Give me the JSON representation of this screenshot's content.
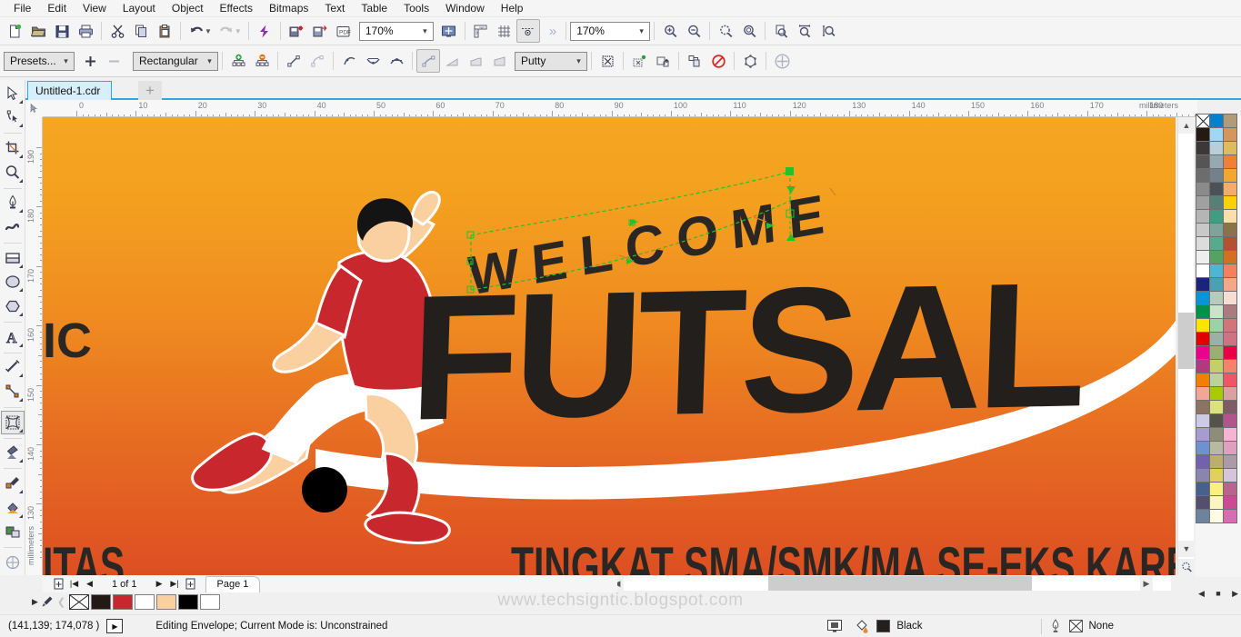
{
  "app": {
    "title": "CorelDRAW",
    "watermark": "www.techsigntic.blogspot.com"
  },
  "menubar": {
    "items": [
      {
        "label": "File"
      },
      {
        "label": "Edit"
      },
      {
        "label": "View"
      },
      {
        "label": "Layout"
      },
      {
        "label": "Object"
      },
      {
        "label": "Effects"
      },
      {
        "label": "Bitmaps"
      },
      {
        "label": "Text"
      },
      {
        "label": "Table"
      },
      {
        "label": "Tools"
      },
      {
        "label": "Window"
      },
      {
        "label": "Help"
      }
    ]
  },
  "toolbar": {
    "zoom_level": "170%",
    "view_zoom": "170%",
    "overflow_label": "»",
    "buttons": [
      {
        "name": "new-document",
        "icon": "new-file-icon"
      },
      {
        "name": "open-document",
        "icon": "folder-open-icon"
      },
      {
        "name": "save-document",
        "icon": "save-icon"
      },
      {
        "name": "print-document",
        "icon": "printer-icon"
      },
      {
        "name": "cut",
        "icon": "scissors-icon"
      },
      {
        "name": "copy",
        "icon": "copy-icon"
      },
      {
        "name": "paste",
        "icon": "paste-icon"
      },
      {
        "name": "undo",
        "icon": "undo-icon"
      },
      {
        "name": "redo",
        "icon": "redo-icon"
      },
      {
        "name": "search-content",
        "icon": "corel-connect-icon"
      },
      {
        "name": "import",
        "icon": "import-icon"
      },
      {
        "name": "export",
        "icon": "export-icon"
      },
      {
        "name": "publish-to-pdf",
        "icon": "pdf-icon"
      },
      {
        "name": "full-screen-preview",
        "icon": "fullscreen-icon"
      },
      {
        "name": "show-rulers",
        "icon": "ruler-icon"
      },
      {
        "name": "show-grid",
        "icon": "grid-icon"
      },
      {
        "name": "show-guidelines",
        "icon": "guidelines-icon"
      },
      {
        "name": "zoom-in",
        "icon": "zoom-in-icon"
      },
      {
        "name": "zoom-out",
        "icon": "zoom-out-icon"
      },
      {
        "name": "zoom-to-selection",
        "icon": "zoom-selection-icon"
      },
      {
        "name": "zoom-to-all-objects",
        "icon": "zoom-all-icon"
      },
      {
        "name": "zoom-to-page",
        "icon": "zoom-page-icon"
      },
      {
        "name": "zoom-to-page-width",
        "icon": "zoom-width-icon"
      },
      {
        "name": "zoom-to-page-height",
        "icon": "zoom-height-icon"
      }
    ]
  },
  "propertybar": {
    "presets_label": "Presets...",
    "add_preset_label": "+",
    "remove_preset_label": "−",
    "envelope_mode": "Rectangular",
    "mapping_mode": "Putty",
    "buttons": [
      {
        "name": "add-node",
        "icon": "add-node-icon"
      },
      {
        "name": "delete-node",
        "icon": "delete-node-icon"
      },
      {
        "name": "convert-to-line",
        "icon": "line-node-icon"
      },
      {
        "name": "convert-to-curve",
        "icon": "curve-node-icon"
      },
      {
        "name": "make-node-cusp",
        "icon": "cusp-node-icon"
      },
      {
        "name": "make-node-smooth",
        "icon": "smooth-node-icon"
      },
      {
        "name": "make-node-symmetrical",
        "icon": "symmetrical-node-icon"
      },
      {
        "name": "envelope-unconstrained",
        "icon": "unconstrained-icon"
      },
      {
        "name": "envelope-single-arc",
        "icon": "single-arc-icon"
      },
      {
        "name": "envelope-double-arc",
        "icon": "double-arc-icon"
      },
      {
        "name": "envelope-straight-line",
        "icon": "straight-line-icon"
      },
      {
        "name": "keep-lines",
        "icon": "keep-lines-icon"
      },
      {
        "name": "add-new-envelope",
        "icon": "add-envelope-icon"
      },
      {
        "name": "create-envelope-from",
        "icon": "copy-envelope-icon"
      },
      {
        "name": "copy-envelope-properties",
        "icon": "copy-props-icon"
      },
      {
        "name": "clear-envelope",
        "icon": "clear-envelope-icon"
      },
      {
        "name": "reset-envelope",
        "icon": "reset-envelope-icon"
      },
      {
        "name": "add-preset-plus",
        "icon": "plus-circle-icon"
      }
    ]
  },
  "document": {
    "tab_label": "Untitled-1.cdr",
    "new_tab_label": "+"
  },
  "rulers": {
    "unit": "millimeters",
    "horizontal_labels": [
      0,
      10,
      20,
      30,
      40,
      50,
      60,
      70,
      80,
      90,
      100,
      110,
      120,
      130,
      140,
      150,
      160,
      170,
      180
    ],
    "vertical_labels": [
      190,
      180,
      170,
      160,
      150,
      140,
      130
    ]
  },
  "toolbox": {
    "items": [
      {
        "name": "pick-tool",
        "icon": "arrow-cursor-icon",
        "active": false
      },
      {
        "name": "shape-edit-tool",
        "icon": "shape-node-icon",
        "active": false
      },
      {
        "name": "crop-tool",
        "icon": "crop-icon",
        "active": false
      },
      {
        "name": "zoom-tool",
        "icon": "magnifier-icon",
        "active": false
      },
      {
        "name": "freehand-tool",
        "icon": "pen-nib-icon",
        "active": false
      },
      {
        "name": "artistic-media-tool",
        "icon": "brush-stroke-icon",
        "active": false
      },
      {
        "name": "rectangle-tool",
        "icon": "rectangle-icon",
        "active": false
      },
      {
        "name": "ellipse-tool",
        "icon": "ellipse-icon",
        "active": false
      },
      {
        "name": "polygon-tool",
        "icon": "polygon-icon",
        "active": false
      },
      {
        "name": "text-tool",
        "icon": "letter-a-icon",
        "active": false
      },
      {
        "name": "parallel-dimension-tool",
        "icon": "dimension-icon",
        "active": false
      },
      {
        "name": "straight-line-connector-tool",
        "icon": "connector-icon",
        "active": false
      },
      {
        "name": "envelope-tool",
        "icon": "envelope-distort-icon",
        "active": true
      },
      {
        "name": "transparency-tool",
        "icon": "transparency-icon",
        "active": false
      },
      {
        "name": "color-eyedropper-tool",
        "icon": "eyedropper-icon",
        "active": false
      },
      {
        "name": "interactive-fill-tool",
        "icon": "fill-bucket-icon",
        "active": false
      },
      {
        "name": "smart-fill-tool",
        "icon": "smart-fill-icon",
        "active": false
      },
      {
        "name": "outline-tool",
        "icon": "outline-pen-icon",
        "active": false
      }
    ]
  },
  "artwork": {
    "welcome_text": "WELCOME",
    "main_text": "FUTSAL",
    "bottom_text": "TINGKAT SMA/SMK/MA SE-EKS KARESIDENAN",
    "left_clipped_text": "IC",
    "left_clipped_text2": "ITAS",
    "colors": {
      "bg_top": "#f5a623",
      "bg_bottom": "#dd4f22",
      "jersey_red": "#c8282d",
      "skin": "#fbd0a0",
      "hair_black": "#1a1a1a",
      "shorts_white": "#ffffff",
      "text_dark": "#231f1c"
    }
  },
  "selection": {
    "mode": "envelope-editing",
    "handle_color": "#22c32a"
  },
  "pagenav": {
    "add_page_start_label": "add-page",
    "first_label": "|◀",
    "prev_label": "◀",
    "page_count": "1 of 1",
    "next_label": "▶",
    "last_label": "▶|",
    "add_page_end_label": "add-page",
    "page_tab": "Page 1"
  },
  "statusbar": {
    "coordinates": "(141,139; 174,078 )",
    "message": "Editing Envelope;  Current Mode is: Unconstrained",
    "fill_label": "Black",
    "fill_color": "#231f1c",
    "outline_label": "None"
  },
  "color_strip": {
    "swatches": [
      {
        "name": "no-color",
        "color": "none"
      },
      {
        "name": "dark-brown",
        "color": "#231a16"
      },
      {
        "name": "red",
        "color": "#c8282d"
      },
      {
        "name": "white",
        "color": "#ffffff"
      },
      {
        "name": "skin-peach",
        "color": "#fbd0a0"
      },
      {
        "name": "black",
        "color": "#000000"
      },
      {
        "name": "white-2",
        "color": "#ffffff"
      }
    ]
  },
  "palette": {
    "rows": [
      [
        "none",
        "#0580cd",
        "#b29b76"
      ],
      [
        "#231a12",
        "#9fd7f5",
        "#d6955a"
      ],
      [
        "#3c3838",
        "#b8ced9",
        "#ddbb5f"
      ],
      [
        "#555555",
        "#96a8b2",
        "#ef8037"
      ],
      [
        "#6d6d6d",
        "#73818c",
        "#f4a72f"
      ],
      [
        "#8a8a8a",
        "#4b5257",
        "#f5ac68"
      ],
      [
        "#a0a0a0",
        "#548075",
        "#fbd00a"
      ],
      [
        "#b5b5b5",
        "#3f9d82",
        "#fcddab"
      ],
      [
        "#c8c8c8",
        "#7ea39c",
        "#8b7248"
      ],
      [
        "#dcdcdc",
        "#55ab8b",
        "#b15233"
      ],
      [
        "#eeeeee",
        "#55a35e",
        "#d46e22"
      ],
      [
        "#ffffff",
        "#4fb6d2",
        "#f3805e"
      ],
      [
        "#1b237d",
        "#4ba0b6",
        "#f5a887"
      ],
      [
        "#0593d9",
        "#b4cbbe",
        "#f8dcd3"
      ],
      [
        "#00914a",
        "#cbe3cb",
        "#ab7b80"
      ],
      [
        "#fce300",
        "#9bd4a4",
        "#d2747a"
      ],
      [
        "#e00000",
        "#9cb0a6",
        "#cf7284"
      ],
      [
        "#ec008c",
        "#9bae74",
        "#ea0046"
      ],
      [
        "#b03a7d",
        "#c5cf6a",
        "#f4836d"
      ],
      [
        "#f08000",
        "#bcd29c",
        "#ef5566"
      ],
      [
        "#f4a59a",
        "#a9cc00",
        "#d9a2a0"
      ],
      [
        "#8c7263",
        "#dae27e",
        "#7f5b66"
      ],
      [
        "#cdcbe3",
        "#55524a",
        "#b3558c"
      ],
      [
        "#a89bd0",
        "#8d8d79",
        "#f4b4d2"
      ],
      [
        "#6e92d0",
        "#b7b9a0",
        "#dfa0c0"
      ],
      [
        "#7361ae",
        "#bcae6d",
        "#ad9aa7"
      ],
      [
        "#8a85ad",
        "#e3cf5e",
        "#d6c4da"
      ],
      [
        "#46618e",
        "#faf07e",
        "#b9648f"
      ],
      [
        "#544f6d",
        "#fbf5c1",
        "#cb4a94"
      ],
      [
        "#6c83a0",
        "#fdfbe2",
        "#d86cb4"
      ]
    ]
  }
}
